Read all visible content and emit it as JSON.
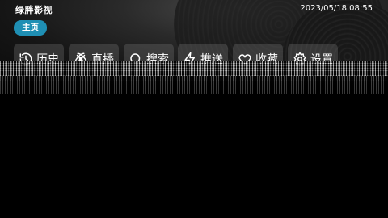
{
  "app": {
    "title": "绿胖影视"
  },
  "status": {
    "datetime": "2023/05/18 08:55"
  },
  "tabs": {
    "home": "主页"
  },
  "nav": [
    {
      "label": "历史",
      "icon": "history-icon"
    },
    {
      "label": "直播",
      "icon": "live-icon"
    },
    {
      "label": "搜索",
      "icon": "search-icon"
    },
    {
      "label": "推送",
      "icon": "push-icon"
    },
    {
      "label": "收藏",
      "icon": "heart-icon"
    },
    {
      "label": "设置",
      "icon": "settings-icon"
    }
  ],
  "colors": {
    "accent": "#1f8fb4",
    "background": "#000000"
  }
}
